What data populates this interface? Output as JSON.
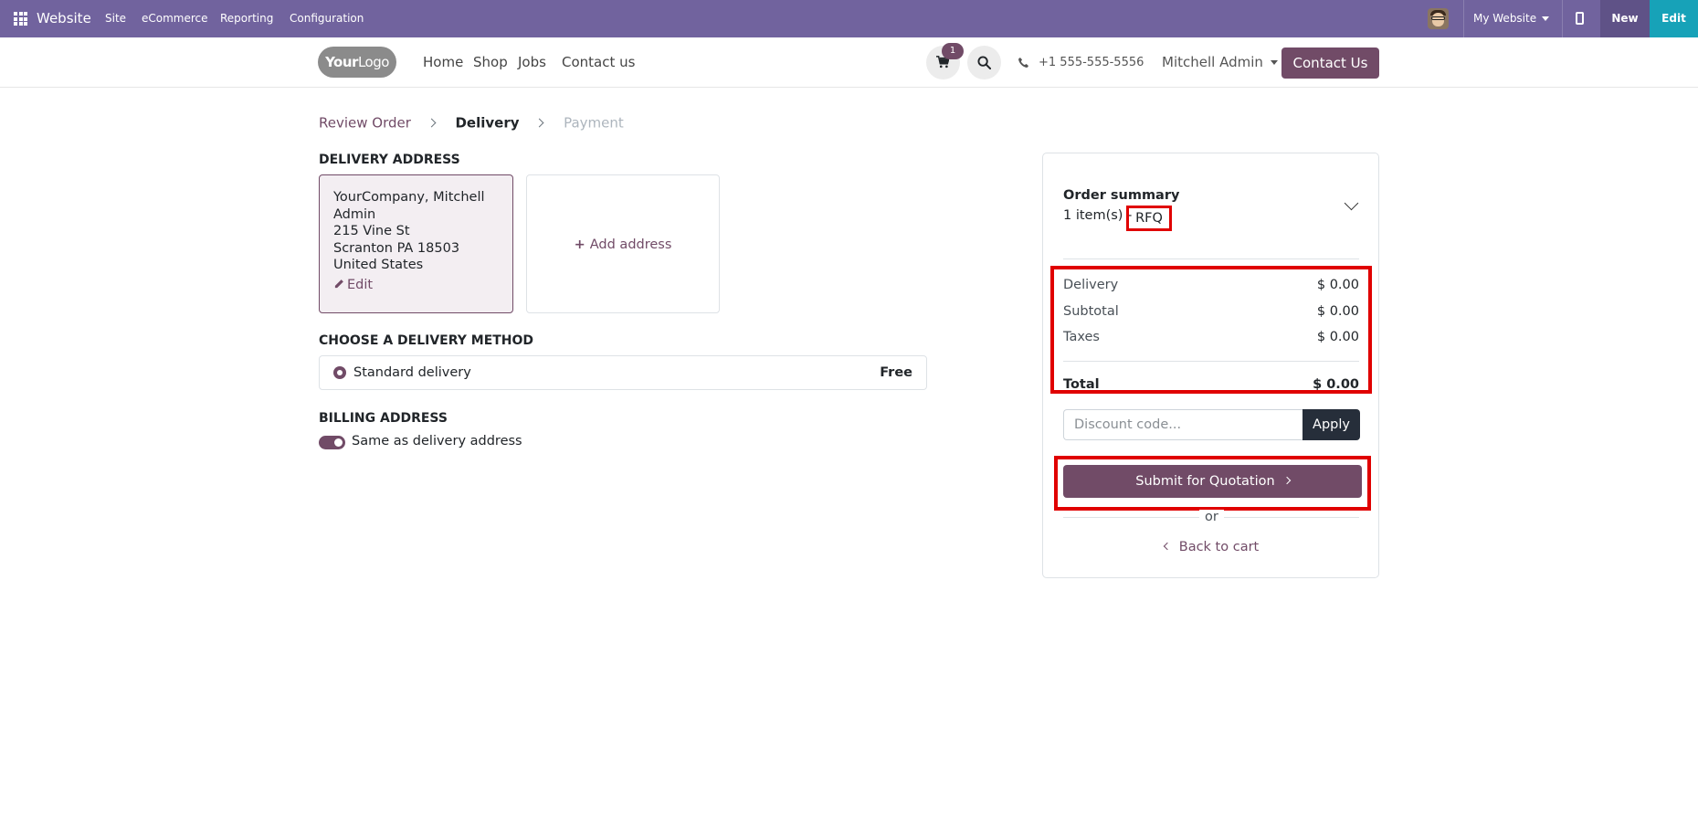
{
  "topbar": {
    "brand": "Website",
    "menus": [
      "Site",
      "eCommerce",
      "Reporting",
      "Configuration"
    ],
    "website_selector": "My Website",
    "new_label": "New",
    "edit_label": "Edit"
  },
  "header": {
    "logo_main": "Your",
    "logo_sub": "Logo",
    "nav": [
      "Home",
      "Shop",
      "Jobs",
      "Contact us"
    ],
    "cart_count": "1",
    "phone": "+1 555-555-5556",
    "user": "Mitchell Admin",
    "contact_button": "Contact Us"
  },
  "breadcrumb": {
    "step1": "Review Order",
    "step2": "Delivery",
    "step3": "Payment"
  },
  "delivery_address": {
    "title": "DELIVERY ADDRESS",
    "name_line1": "YourCompany, Mitchell",
    "name_line2": "Admin",
    "street": "215 Vine St",
    "city": "Scranton PA 18503",
    "country": "United States",
    "edit_label": "Edit",
    "add_label": "Add address"
  },
  "delivery_method": {
    "title": "CHOOSE A DELIVERY METHOD",
    "name": "Standard delivery",
    "price": "Free"
  },
  "billing": {
    "title": "BILLING ADDRESS",
    "toggle_label": "Same as delivery address",
    "toggle_on": true
  },
  "summary": {
    "title": "Order summary",
    "items": "1 item(s) -",
    "badge": "RFQ",
    "rows": [
      {
        "label": "Delivery",
        "amount": "$ 0.00"
      },
      {
        "label": "Subtotal",
        "amount": "$ 0.00"
      },
      {
        "label": "Taxes",
        "amount": "$ 0.00"
      }
    ],
    "total_label": "Total",
    "total_amount": "$ 0.00",
    "discount_placeholder": "Discount code...",
    "apply_label": "Apply",
    "submit_label": "Submit for Quotation",
    "or_label": "or",
    "back_label": "Back to cart"
  },
  "colors": {
    "topbar": "#71639e",
    "primary": "#714b67",
    "highlight": "#e00000",
    "edit_button": "#17a2b8"
  }
}
